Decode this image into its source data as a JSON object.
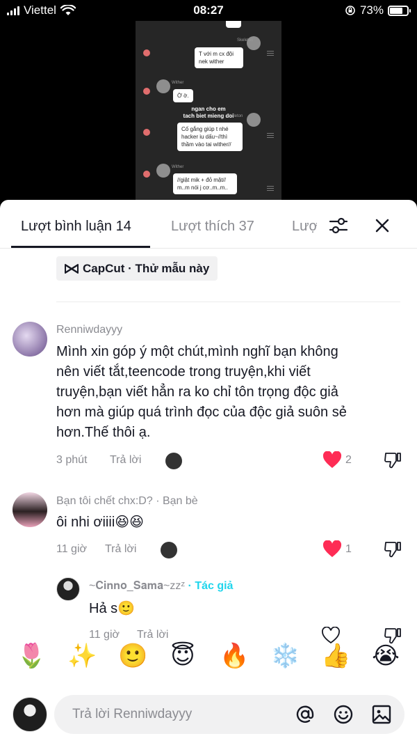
{
  "status_bar": {
    "carrier": "Viettel",
    "time": "08:27",
    "battery": "73%",
    "battery_level": 0.73
  },
  "video": {
    "names": [
      "Skeleton",
      "Wither",
      "Skeleton",
      "Wither"
    ],
    "messages": [
      "T với m cx đội\nnek wither",
      "Ờ ờ.",
      "Cố gắng giúp t nhé\nhacker iu dấu~//thì\nthầm vào tai wither//",
      "//giật mik + đỏ mặt//\nm..m nói j cơ..m..m.."
    ],
    "caption": "ngan cho em\ntach biet mieng doi"
  },
  "tabs": [
    {
      "label": "Lượt bình luận 14"
    },
    {
      "label": "Lượt thích 37"
    },
    {
      "label": "Lượt"
    }
  ],
  "capcut": {
    "label": "CapCut · Thử mẫu này"
  },
  "comments": [
    {
      "user": "Renniwdayyy",
      "text": "Mình xin góp ý một chút,mình nghĩ bạn không\nnên viết tắt,teencode trong truyện,khi viết\ntruyện,bạn viết hẳn ra ko chỉ tôn trọng độc giả\nhơn mà giúp quá trình đọc của độc giả suôn sẻ\nhơn.Thế thôi ạ.",
      "time": "3 phút",
      "reply": "Trả lời",
      "likes": "2"
    },
    {
      "user": "Bạn tôi chết chx:D? · Bạn bè",
      "text": "ôi nhi ơiiii😆😆",
      "time": "11 giờ",
      "reply": "Trả lời",
      "likes": "1"
    },
    {
      "user": "~𝐂𝐢𝐧𝐧𝐨_𝐒𝐚𝐦𝐚~zzᶻ",
      "badge": "· Tác giả",
      "text": "Hả s🙂",
      "time": "11 giờ",
      "reply": "Trả lời"
    }
  ],
  "emojis": [
    "🌷",
    "✨",
    "🙂",
    "😇",
    "🔥",
    "❄️",
    "👍",
    "😭"
  ],
  "input": {
    "placeholder": "Trả lời Renniwdayyy"
  },
  "colors": {
    "like_red": "#fe2c55",
    "author_cyan": "#20d5ec"
  }
}
